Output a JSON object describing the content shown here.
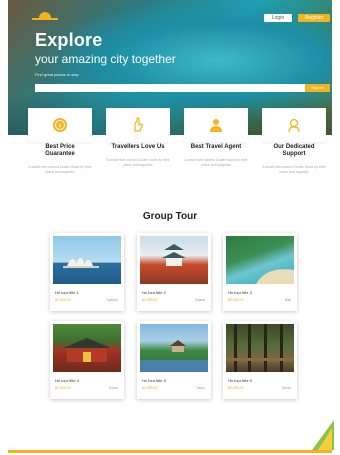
{
  "header": {
    "login_label": "Login",
    "register_label": "Register"
  },
  "hero": {
    "title": "Explore",
    "subtitle": "your amazing city together",
    "hint": "Find great places to stay",
    "search_placeholder": "",
    "search_button": "Search"
  },
  "features": [
    {
      "title_line1": "Best Price",
      "title_line2": "Guarantee",
      "text": "A small river named Duden flows by their place and supplies",
      "icon": "price-tag-icon"
    },
    {
      "title_line1": "Travellers Love Us",
      "title_line2": "",
      "text": "A small river named Duden flows by their place and supplies",
      "icon": "hand-icon"
    },
    {
      "title_line1": "Best Travel Agent",
      "title_line2": "",
      "text": "A small river named Duden flows by their place and supplies",
      "icon": "agent-icon"
    },
    {
      "title_line1": "Our Dedicated",
      "title_line2": "Support",
      "text": "A small river named Duden flows by their place and supplies",
      "icon": "support-icon"
    }
  ],
  "group_tour": {
    "title": "Group Tour",
    "tours": [
      {
        "title": "Ho tour title 1",
        "price": "$2,999.00",
        "tag": "Sydney"
      },
      {
        "title": "Ho tour title 2",
        "price": "$2,999.00",
        "tag": "Osaka"
      },
      {
        "title": "Ho tour title 3",
        "price": "$2,999.00",
        "tag": "Bali"
      },
      {
        "title": "Ho tour title 4",
        "price": "$2,999.00",
        "tag": "Kyoto"
      },
      {
        "title": "Ho tour title 5",
        "price": "$2,999.00",
        "tag": "Tokyo"
      },
      {
        "title": "Ho tour title 6",
        "price": "$2,999.00",
        "tag": "Seoul"
      }
    ]
  },
  "colors": {
    "accent": "#f4b31e",
    "text": "#222222",
    "muted": "#aaaaaa"
  }
}
